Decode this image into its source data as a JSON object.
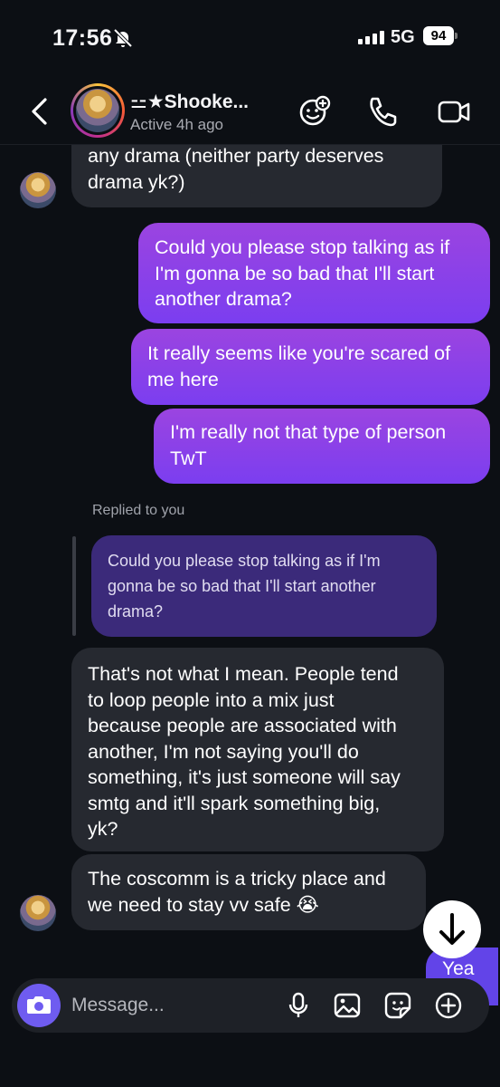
{
  "status_bar": {
    "time": "17:56",
    "network": "5G",
    "battery": "94"
  },
  "header": {
    "name": "⚍★Shooke...",
    "status": "Active 4h ago"
  },
  "messages": {
    "m1": [
      "any drama (neither party deserves",
      "drama yk?)"
    ],
    "m2": [
      "Could you please stop talking as if",
      "I'm gonna be so bad that I'll start",
      "another drama?"
    ],
    "m3": [
      "It really seems like you're scared of",
      "me here"
    ],
    "m4": [
      "I'm really not that type of person",
      "TwT"
    ],
    "reply_label": "Replied to you",
    "reply_quote": [
      "Could you please stop talking as if I'm",
      "gonna be so bad that I'll start another",
      "drama?"
    ],
    "m5": [
      "That's not what I mean. People tend",
      "to loop people into a mix just",
      "because people are associated with",
      "another, I'm not saying you'll do",
      "something, it's just someone will say",
      "smtg and it'll spark something big,",
      "yk?"
    ],
    "m6": [
      "The coscomm is a tricky place and",
      "we need to stay vv safe 😭"
    ],
    "m7": "Yea"
  },
  "composer": {
    "placeholder": "Message..."
  },
  "colors": {
    "background": "#0c0f14",
    "incoming_bubble": "#262930",
    "outgoing_bubble_top": "#9b44e0",
    "outgoing_bubble_bottom": "#7b3ef0",
    "accent": "#6f5cf0"
  },
  "icons": [
    "bell-slash-icon",
    "chevron-left-icon",
    "effects-icon",
    "phone-icon",
    "video-camera-icon",
    "camera-icon",
    "microphone-icon",
    "image-icon",
    "sticker-icon",
    "plus-icon",
    "arrow-down-icon"
  ]
}
